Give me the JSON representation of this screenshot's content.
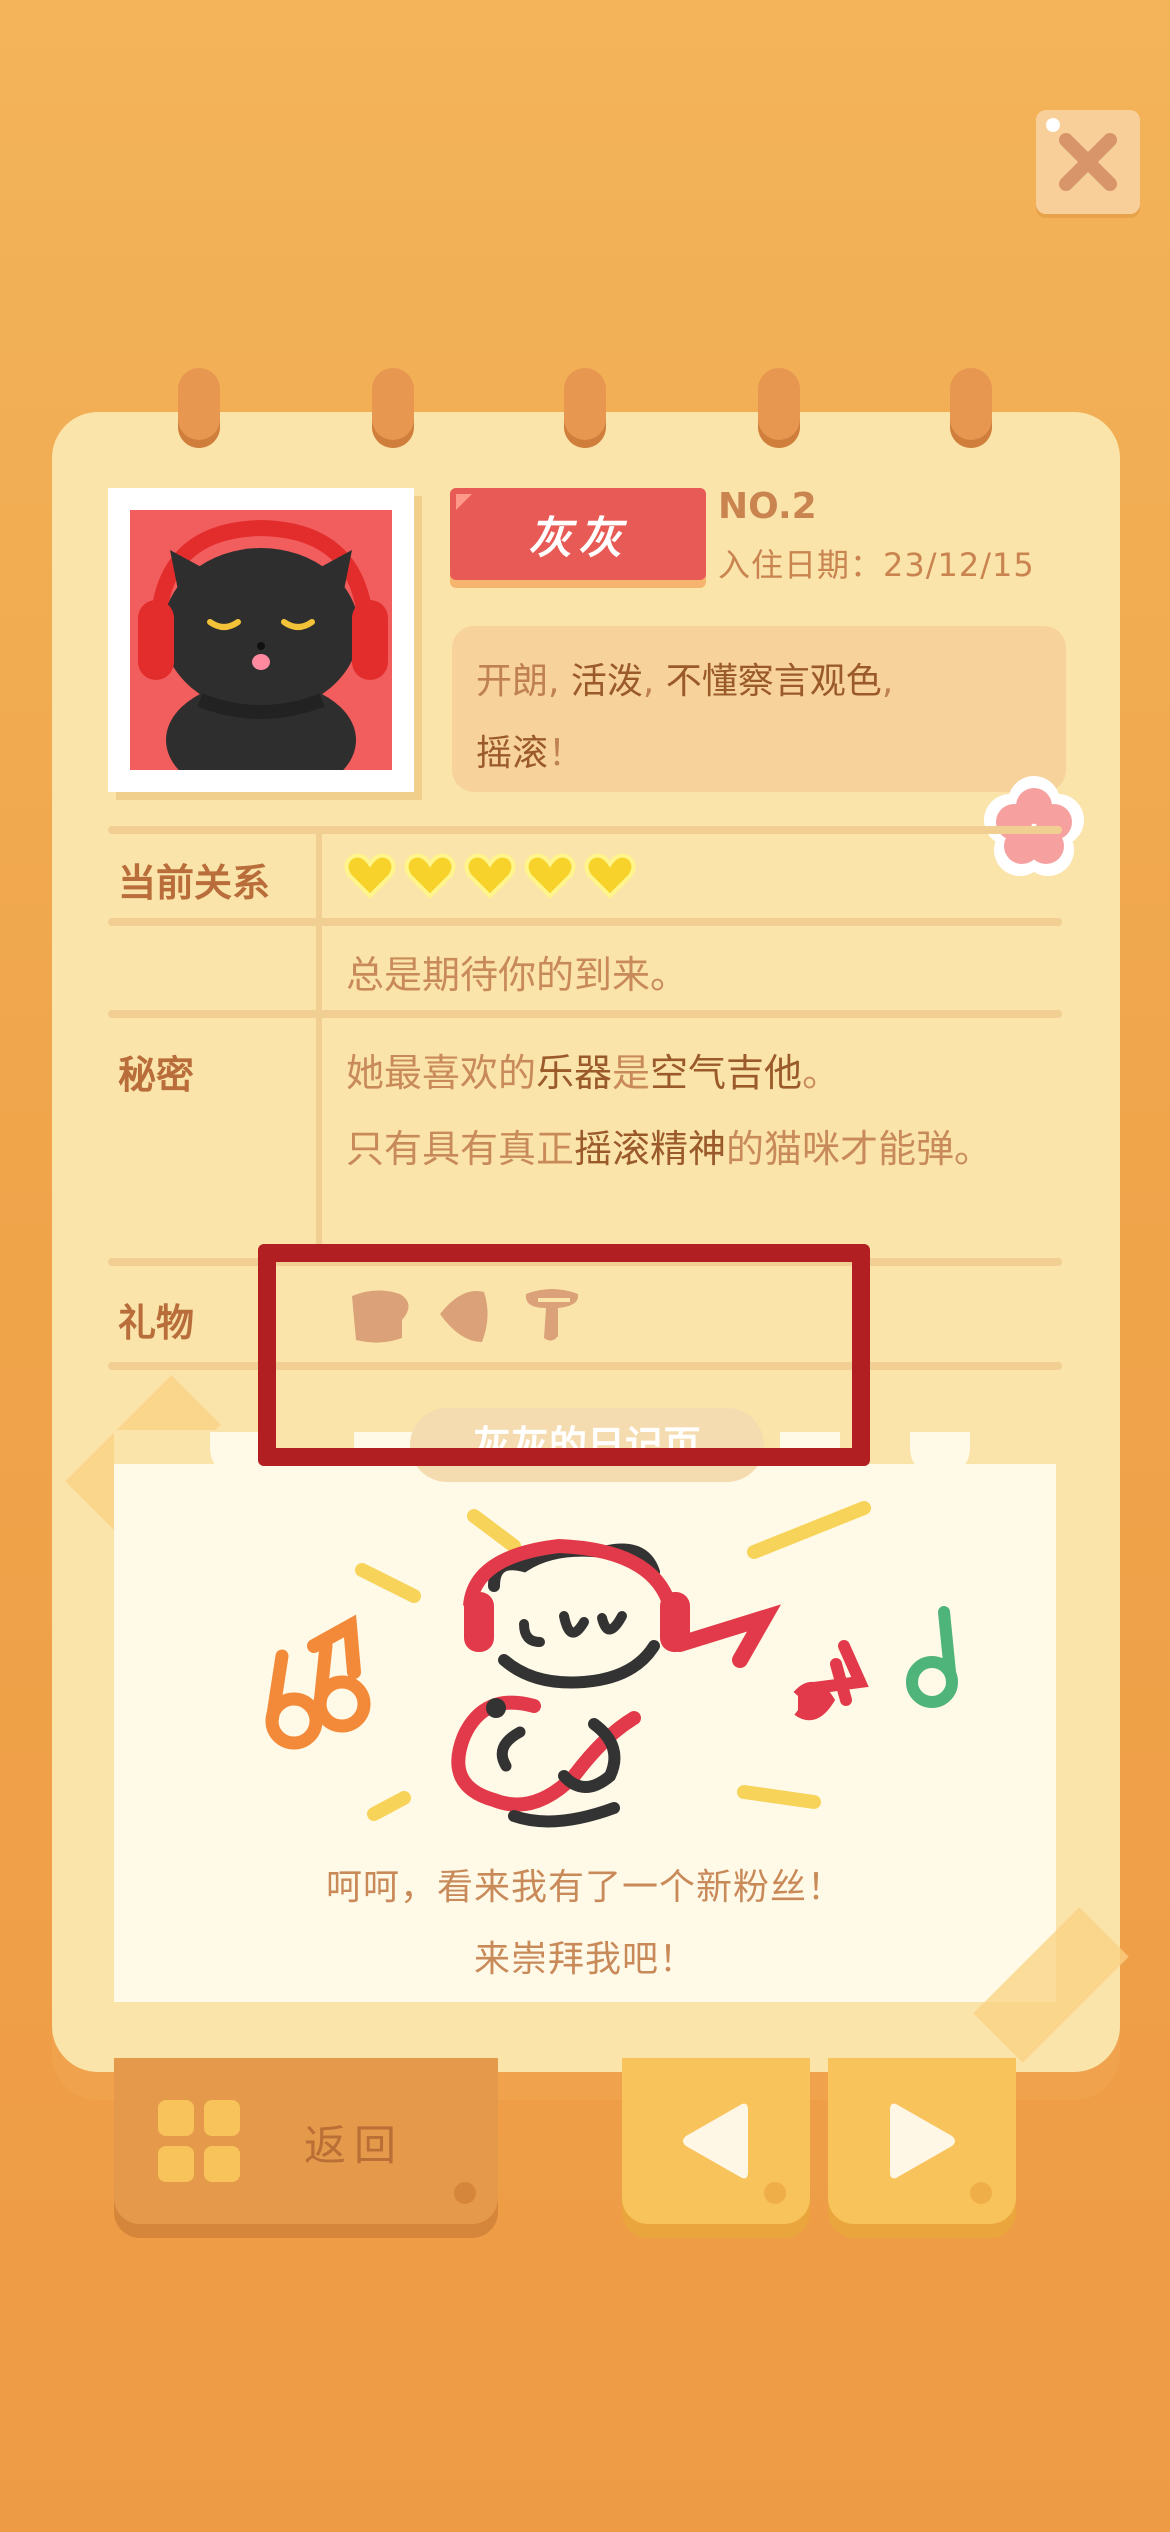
{
  "profile": {
    "name": "灰灰",
    "number": "NO.2",
    "checkin": "入住日期：23/12/15",
    "traits": [
      {
        "text": "开朗, ",
        "strong": false
      },
      {
        "text": "活泼",
        "strong": true
      },
      {
        "text": ", ",
        "strong": false
      },
      {
        "text": "不懂察言观色",
        "strong": true
      },
      {
        "text": ",",
        "strong": false
      },
      {
        "text": "摇滚",
        "strong": true
      },
      {
        "text": "！",
        "strong": false
      }
    ]
  },
  "relationship": {
    "label": "当前关系",
    "hearts_filled": 5,
    "hearts_total": 5,
    "description": "总是期待你的到来。",
    "heart_color": "#f7d22a"
  },
  "secret": {
    "label": "秘密",
    "line1": [
      {
        "text": "她最喜欢的",
        "strong": false
      },
      {
        "text": "乐器",
        "strong": true
      },
      {
        "text": "是",
        "strong": false
      },
      {
        "text": "空气吉他",
        "strong": true
      },
      {
        "text": "。",
        "strong": false
      }
    ],
    "line2": [
      {
        "text": "只有具有真正",
        "strong": false
      },
      {
        "text": "摇滚精神",
        "strong": true
      },
      {
        "text": "的猫咪才能弹。",
        "strong": false
      }
    ]
  },
  "gifts": {
    "label": "礼物",
    "items": [
      "bread-gift-icon",
      "fish-gift-icon",
      "mushroom-gift-icon"
    ]
  },
  "diary": {
    "title": "灰灰的日记页",
    "line1": "呵呵，看来我有了一个新粉丝！",
    "line2": "来崇拜我吧！"
  },
  "nav": {
    "back_label": "返回"
  },
  "colors": {
    "accent_red": "#e85a55",
    "highlight": "#b21f22",
    "note_green": "#4fb47a",
    "note_orange": "#f28a3a"
  }
}
